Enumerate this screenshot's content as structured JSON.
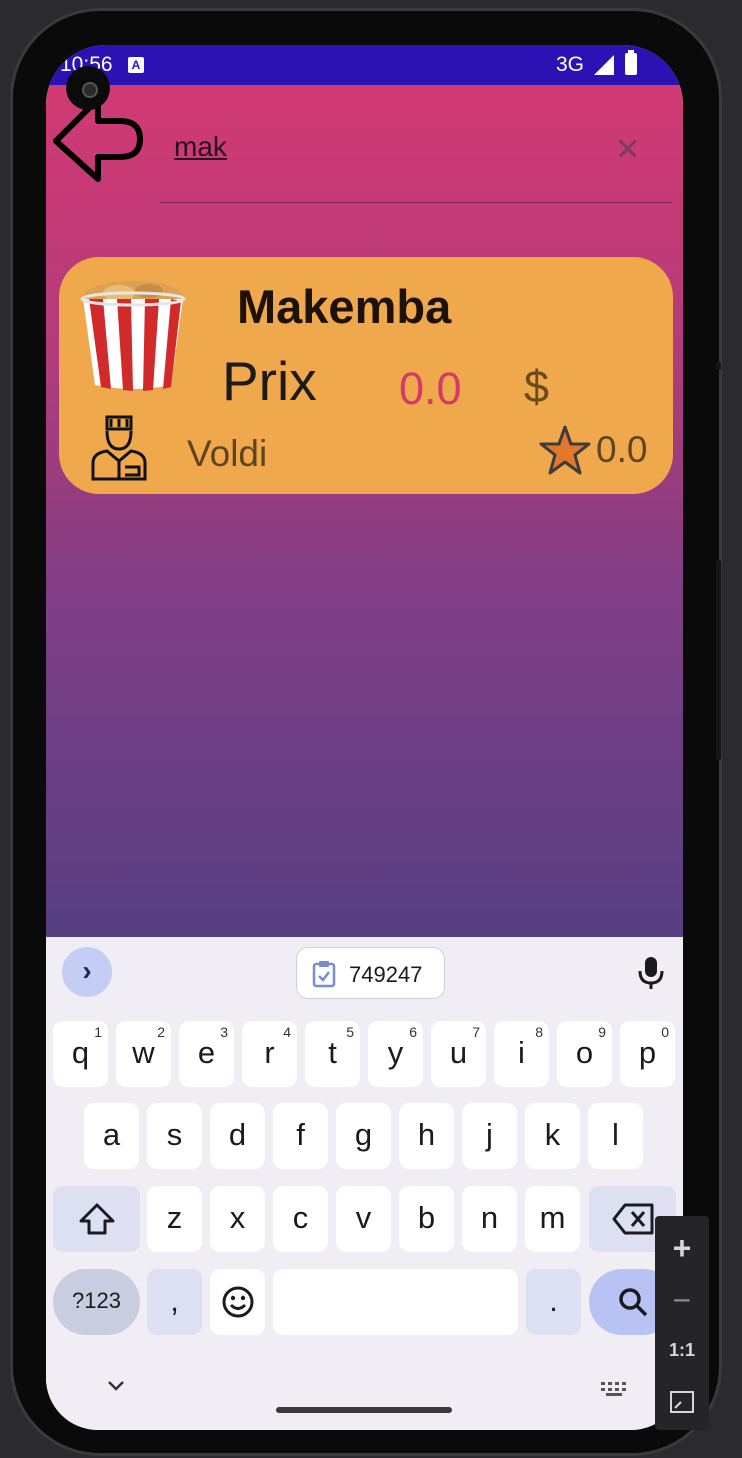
{
  "status_bar": {
    "time": "10:56",
    "notification_icon": "A",
    "network": "3G",
    "signal_icon": "signal-icon",
    "battery_icon": "battery-icon"
  },
  "search": {
    "back_icon": "arrow-left-icon",
    "query": "mak",
    "clear_icon": "close-icon"
  },
  "results": [
    {
      "name": "Makemba",
      "price_label": "Prix",
      "price": "0.0",
      "currency": "$",
      "cook": "Voldi",
      "rating": "0.0",
      "image_icon": "fries-bucket-icon",
      "cook_icon": "chef-icon",
      "rating_icon": "star-icon"
    }
  ],
  "keyboard": {
    "clipboard": "749247",
    "row1": [
      {
        "k": "q",
        "h": "1"
      },
      {
        "k": "w",
        "h": "2"
      },
      {
        "k": "e",
        "h": "3"
      },
      {
        "k": "r",
        "h": "4"
      },
      {
        "k": "t",
        "h": "5"
      },
      {
        "k": "y",
        "h": "6"
      },
      {
        "k": "u",
        "h": "7"
      },
      {
        "k": "i",
        "h": "8"
      },
      {
        "k": "o",
        "h": "9"
      },
      {
        "k": "p",
        "h": "0"
      }
    ],
    "row2": [
      "a",
      "s",
      "d",
      "f",
      "g",
      "h",
      "j",
      "k",
      "l"
    ],
    "row3": [
      "z",
      "x",
      "c",
      "v",
      "b",
      "n",
      "m"
    ],
    "mode_key": "?123",
    "comma_key": ",",
    "period_key": ".",
    "emoji_icon": "emoji-icon",
    "search_icon": "search-icon",
    "shift_icon": "shift-icon",
    "backspace_icon": "backspace-icon",
    "mic_icon": "mic-icon"
  },
  "emulator_zoom": {
    "plus": "+",
    "minus": "−",
    "one_to_one": "1:1"
  },
  "colors": {
    "status_bar": "#2c12b4",
    "card": "#efa84c",
    "price": "#d5386c",
    "gradient_top": "#d23a72",
    "gradient_bottom": "#563f82"
  }
}
